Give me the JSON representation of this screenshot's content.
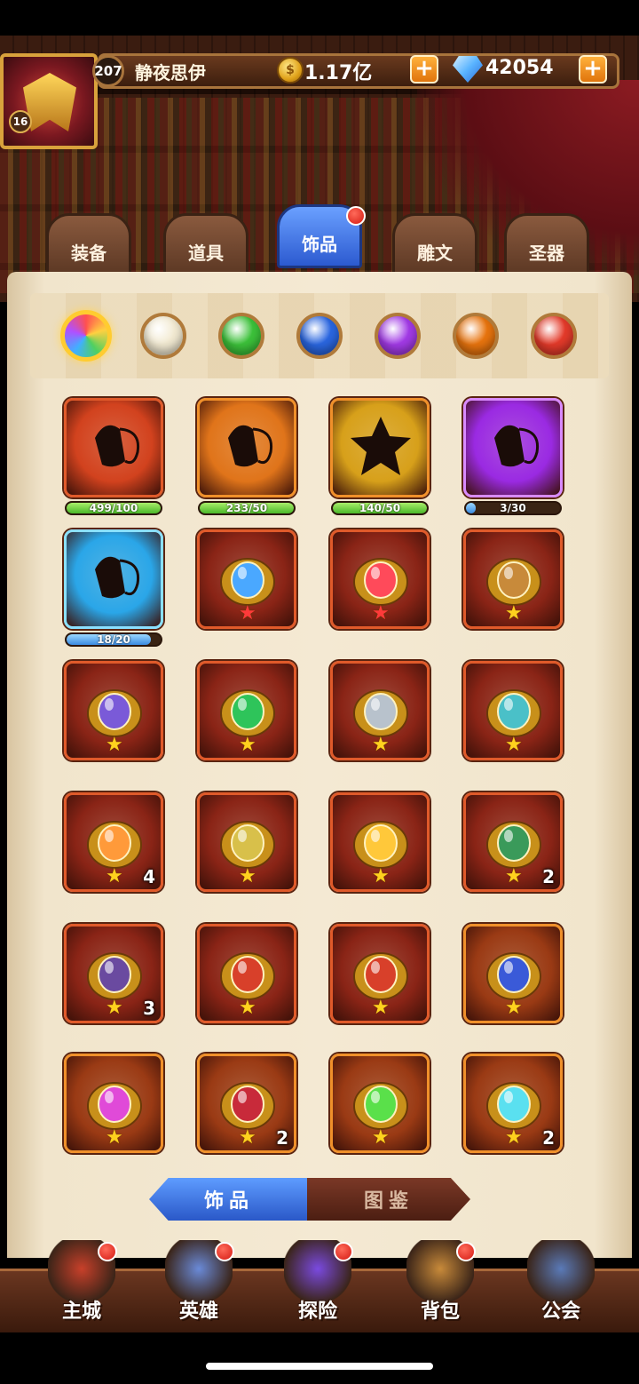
{
  "player": {
    "avatar_level": "16",
    "level": "207",
    "name": "静夜思伊",
    "gold": "1.17亿",
    "gems": "42054"
  },
  "category_tabs": [
    {
      "label": "装备",
      "active": false
    },
    {
      "label": "道具",
      "active": false
    },
    {
      "label": "饰品",
      "active": true
    },
    {
      "label": "雕文",
      "active": false
    },
    {
      "label": "圣器",
      "active": false
    }
  ],
  "filters": [
    {
      "name": "all",
      "color": "rainbow",
      "selected": true
    },
    {
      "name": "white",
      "color": "#f2ead2"
    },
    {
      "name": "green",
      "color": "#3cc23a"
    },
    {
      "name": "blue",
      "color": "#2a66e0"
    },
    {
      "name": "purple",
      "color": "#a23ae6"
    },
    {
      "name": "orange",
      "color": "#e8740e"
    },
    {
      "name": "red",
      "color": "#e43a2a"
    }
  ],
  "items": [
    {
      "icon": "orange-shard",
      "bg": "#d2421e",
      "progress_label": "499/100",
      "progress": 1.0,
      "bar": "green"
    },
    {
      "icon": "orange-shard",
      "bg": "#e0741a",
      "progress_label": "233/50",
      "progress": 1.0,
      "bar": "green"
    },
    {
      "icon": "gold-star-shard",
      "bg": "#d7a01a",
      "progress_label": "140/50",
      "progress": 1.0,
      "bar": "green"
    },
    {
      "icon": "purple-shard",
      "bg": "#9a2ae2",
      "progress_label": "3/30",
      "progress": 0.1,
      "bar": "blue"
    },
    {
      "icon": "blue-shard",
      "bg": "#2aa6e8",
      "progress_label": "18/20",
      "progress": 0.9,
      "bar": "blue"
    },
    {
      "icon": "blue-crystal-emblem",
      "bg": "#8a2416",
      "star": "red"
    },
    {
      "icon": "red-crystal-emblem",
      "bg": "#8a2416",
      "star": "red"
    },
    {
      "icon": "spell-book",
      "bg": "#8a2416",
      "star": "yellow"
    },
    {
      "icon": "compass-ring",
      "bg": "#8a2416",
      "star": "yellow"
    },
    {
      "icon": "emerald-ring",
      "bg": "#8a2416",
      "star": "yellow"
    },
    {
      "icon": "silver-crest",
      "bg": "#8a2416",
      "star": "yellow"
    },
    {
      "icon": "swirl-amulet",
      "bg": "#8a2416",
      "star": "yellow"
    },
    {
      "icon": "sun-medallion",
      "bg": "#8a2416",
      "star": "yellow",
      "count": "4"
    },
    {
      "icon": "serpent-sword",
      "bg": "#8a2416",
      "star": "yellow"
    },
    {
      "icon": "gold-gem-crest",
      "bg": "#8a2416",
      "star": "yellow"
    },
    {
      "icon": "rune-tome",
      "bg": "#8a2416",
      "star": "yellow",
      "count": "2"
    },
    {
      "icon": "war-horn",
      "bg": "#8a2416",
      "star": "yellow",
      "count": "3"
    },
    {
      "icon": "red-shield-a",
      "bg": "#8a2416",
      "star": "yellow"
    },
    {
      "icon": "red-shield-b",
      "bg": "#8a2416",
      "star": "yellow"
    },
    {
      "icon": "blue-shield",
      "bg": "#9a3a14",
      "star": "yellow"
    },
    {
      "icon": "pink-pendant",
      "bg": "#9a3a14",
      "star": "yellow"
    },
    {
      "icon": "ruby-disk",
      "bg": "#9a3a14",
      "star": "yellow",
      "count": "2"
    },
    {
      "icon": "green-crystal-crown",
      "bg": "#9a3a14",
      "star": "yellow"
    },
    {
      "icon": "aqua-star-brooch",
      "bg": "#9a3a14",
      "star": "yellow",
      "count": "2"
    }
  ],
  "sub_tabs": [
    {
      "label": "饰品",
      "active": true
    },
    {
      "label": "图鉴",
      "active": false
    }
  ],
  "nav": [
    {
      "label": "主城",
      "icon": "castle-icon",
      "badge": true
    },
    {
      "label": "英雄",
      "icon": "hero-icon",
      "badge": true
    },
    {
      "label": "探险",
      "icon": "portal-icon",
      "badge": true
    },
    {
      "label": "背包",
      "icon": "backpack-icon",
      "badge": true
    },
    {
      "label": "公会",
      "icon": "guild-icon",
      "badge": false
    }
  ],
  "symbols": {
    "plus": "+",
    "star": "★",
    "gold": "$"
  }
}
